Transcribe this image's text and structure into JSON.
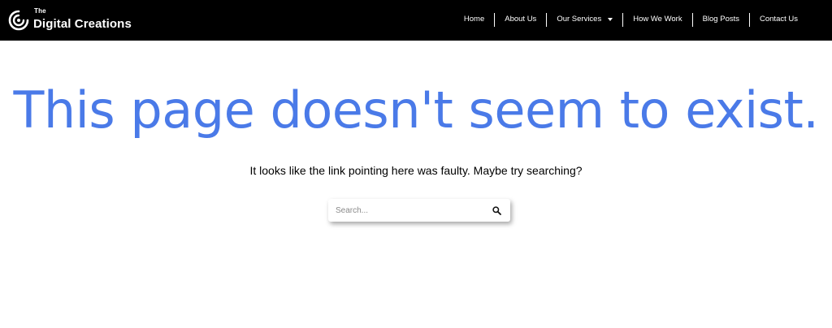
{
  "brand": {
    "small": "The",
    "name": "Digital Creations"
  },
  "nav": {
    "items": [
      {
        "label": "Home"
      },
      {
        "label": "About Us"
      },
      {
        "label": "Our Services"
      },
      {
        "label": "How We Work"
      },
      {
        "label": "Blog Posts"
      },
      {
        "label": "Contact Us"
      }
    ]
  },
  "main": {
    "headline": "This page doesn't seem to exist.",
    "subtext": "It looks like the link pointing here was faulty. Maybe try searching?",
    "search": {
      "placeholder": "Search..."
    }
  },
  "colors": {
    "header_bg": "#000000",
    "headline": "#4a7ae8"
  },
  "icons": {
    "logo": "swirl-logo-icon",
    "services_dropdown": "caret-down-icon",
    "search": "search-icon"
  }
}
